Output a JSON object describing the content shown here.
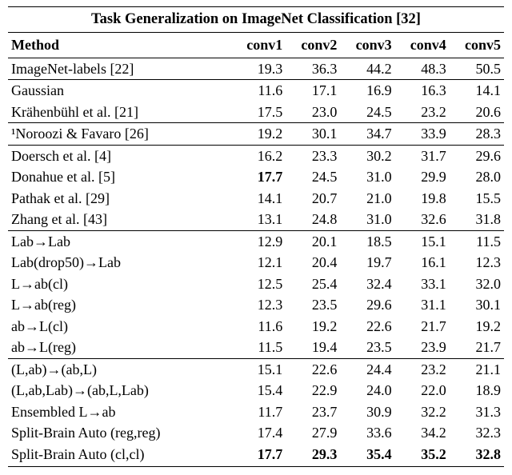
{
  "chart_data": {
    "type": "table",
    "title": "Task Generalization on ImageNet Classification [32]",
    "columns": [
      "Method",
      "conv1",
      "conv2",
      "conv3",
      "conv4",
      "conv5"
    ],
    "groups": [
      {
        "rows": [
          {
            "method": "ImageNet-labels [22]",
            "values": [
              19.3,
              36.3,
              44.2,
              48.3,
              50.5
            ]
          }
        ]
      },
      {
        "rows": [
          {
            "method": "Gaussian",
            "values": [
              11.6,
              17.1,
              16.9,
              16.3,
              14.1
            ]
          },
          {
            "method": "Krähenbühl et al. [21]",
            "values": [
              17.5,
              23.0,
              24.5,
              23.2,
              20.6
            ]
          }
        ]
      },
      {
        "rows": [
          {
            "method": "¹Noroozi & Favaro [26]",
            "values": [
              19.2,
              30.1,
              34.7,
              33.9,
              28.3
            ]
          }
        ]
      },
      {
        "rows": [
          {
            "method": "Doersch et al. [4]",
            "values": [
              16.2,
              23.3,
              30.2,
              31.7,
              29.6
            ]
          },
          {
            "method": "Donahue et al. [5]",
            "values": [
              17.7,
              24.5,
              31.0,
              29.9,
              28.0
            ],
            "bold_cols": [
              0
            ]
          },
          {
            "method": "Pathak et al. [29]",
            "values": [
              14.1,
              20.7,
              21.0,
              19.8,
              15.5
            ]
          },
          {
            "method": "Zhang et al. [43]",
            "values": [
              13.1,
              24.8,
              31.0,
              32.6,
              31.8
            ]
          }
        ]
      },
      {
        "rows": [
          {
            "method": "Lab→Lab",
            "values": [
              12.9,
              20.1,
              18.5,
              15.1,
              11.5
            ]
          },
          {
            "method": "Lab(drop50)→Lab",
            "values": [
              12.1,
              20.4,
              19.7,
              16.1,
              12.3
            ]
          },
          {
            "method": "L→ab(cl)",
            "values": [
              12.5,
              25.4,
              32.4,
              33.1,
              32.0
            ]
          },
          {
            "method": "L→ab(reg)",
            "values": [
              12.3,
              23.5,
              29.6,
              31.1,
              30.1
            ]
          },
          {
            "method": "ab→L(cl)",
            "values": [
              11.6,
              19.2,
              22.6,
              21.7,
              19.2
            ]
          },
          {
            "method": "ab→L(reg)",
            "values": [
              11.5,
              19.4,
              23.5,
              23.9,
              21.7
            ]
          }
        ]
      },
      {
        "rows": [
          {
            "method": "(L,ab)→(ab,L)",
            "values": [
              15.1,
              22.6,
              24.4,
              23.2,
              21.1
            ]
          },
          {
            "method": "(L,ab,Lab)→(ab,L,Lab)",
            "values": [
              15.4,
              22.9,
              24.0,
              22.0,
              18.9
            ]
          },
          {
            "method": "Ensembled L→ab",
            "values": [
              11.7,
              23.7,
              30.9,
              32.2,
              31.3
            ]
          },
          {
            "method": "Split-Brain Auto (reg,reg)",
            "values": [
              17.4,
              27.9,
              33.6,
              34.2,
              32.3
            ]
          },
          {
            "method": "Split-Brain Auto (cl,cl)",
            "values": [
              17.7,
              29.3,
              35.4,
              35.2,
              32.8
            ],
            "bold_cols": [
              0,
              1,
              2,
              3,
              4
            ]
          }
        ]
      }
    ]
  }
}
